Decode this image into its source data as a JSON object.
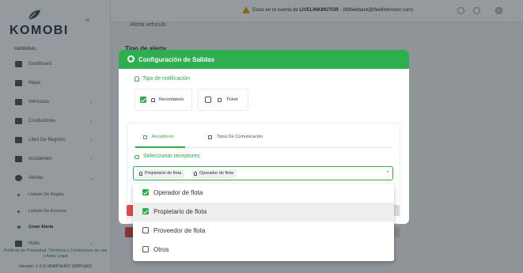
{
  "brand": {
    "logo_text": "KOMOBI",
    "accent": "#2eae4e"
  },
  "topbar": {
    "account_prefix": "Estas en la cuenta de ",
    "account_name": "LIVELINKMOTOR",
    "account_email": " - (lfdfleetback@fleetlinkmotor.com)"
  },
  "sidebar": {
    "section_label": "GENERAL",
    "items": [
      {
        "label": "Dashboard",
        "icon": "dashboard-icon",
        "has_chevron": false
      },
      {
        "label": "Mapa",
        "icon": "map-icon",
        "has_chevron": false
      },
      {
        "label": "Vehículos",
        "icon": "motorcycle-icon",
        "has_chevron": true
      },
      {
        "label": "Conductores",
        "icon": "driver-icon",
        "has_chevron": true
      },
      {
        "label": "Libro De Registro",
        "icon": "book-icon",
        "has_chevron": true
      },
      {
        "label": "Accidentes",
        "icon": "car-crash-icon",
        "has_chevron": true
      },
      {
        "label": "Alertas",
        "icon": "alert-icon",
        "has_chevron": true
      }
    ],
    "sub_items": [
      {
        "label": "Listado De Reglas",
        "active": false
      },
      {
        "label": "Listado De Eventos",
        "active": false
      },
      {
        "label": "Crear Alerta",
        "active": true
      }
    ],
    "last_item": {
      "label": "Hubs",
      "icon": "hub-icon"
    },
    "footer_links": "Políticas de Privacidad, Términos y Condiciones de uso y Aviso Legal",
    "version": "Version: 1.0.0-SNAPSHOT (8087a50)"
  },
  "page": {
    "breadcrumb": "Alerta vehiculo",
    "section_title": "Tipo de alerta"
  },
  "modal": {
    "title": "Configuración de Salidas",
    "notification_type_label": "Tipo de notificación",
    "notification_options": [
      {
        "label": "Recordatorio",
        "checked": true,
        "icon": "bell-icon"
      },
      {
        "label": "Ticket",
        "checked": false,
        "icon": "ticket-icon"
      }
    ],
    "tabs": [
      {
        "label": "Receptores",
        "active": true
      },
      {
        "label": "Tipos De Comunicación",
        "active": false
      }
    ],
    "select_receivers_label": "Seleccionar receptores",
    "selected_chips": [
      "Propietario de flota",
      "Operador de flota"
    ]
  },
  "dropdown": {
    "options": [
      {
        "label": "Operador de flota",
        "checked": true,
        "hover": false
      },
      {
        "label": "Propietario de flota",
        "checked": true,
        "hover": true
      },
      {
        "label": "Proveedor de flota",
        "checked": false,
        "hover": false
      },
      {
        "label": "Otros",
        "checked": false,
        "hover": false
      }
    ]
  }
}
